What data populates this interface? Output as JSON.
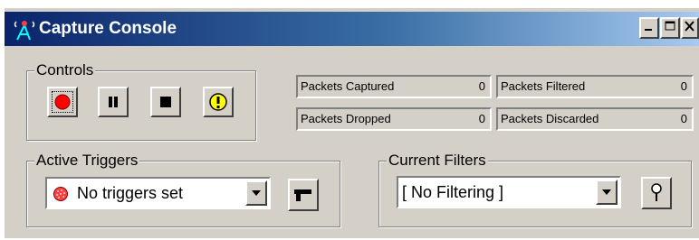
{
  "window": {
    "title": "Capture Console",
    "app_icon": "antenna-icon",
    "caption_buttons": [
      "minimize-icon",
      "maximize-icon",
      "close-icon"
    ]
  },
  "controls": {
    "legend": "Controls",
    "buttons": [
      {
        "name": "record-icon",
        "state": "focused"
      },
      {
        "name": "pause-icon"
      },
      {
        "name": "stop-icon"
      },
      {
        "name": "alert-icon"
      }
    ]
  },
  "stats": [
    {
      "label": "Packets Captured",
      "value": "0"
    },
    {
      "label": "Packets Filtered",
      "value": "0"
    },
    {
      "label": "Packets Dropped",
      "value": "0"
    },
    {
      "label": "Packets Discarded",
      "value": "0"
    }
  ],
  "triggers": {
    "legend": "Active Triggers",
    "selected": "No triggers set",
    "status_icon": "status-dot-icon",
    "trigger_button_icon": "gun-icon"
  },
  "filters": {
    "legend": "Current Filters",
    "selected": "[ No Filtering ]",
    "filter_button_icon": "pin-icon"
  },
  "colors": {
    "title_gradient_start": "#0a246a",
    "title_gradient_end": "#a6caf0",
    "face": "#d4d0c8",
    "record": "#ff0000",
    "alert": "#ffff00"
  }
}
